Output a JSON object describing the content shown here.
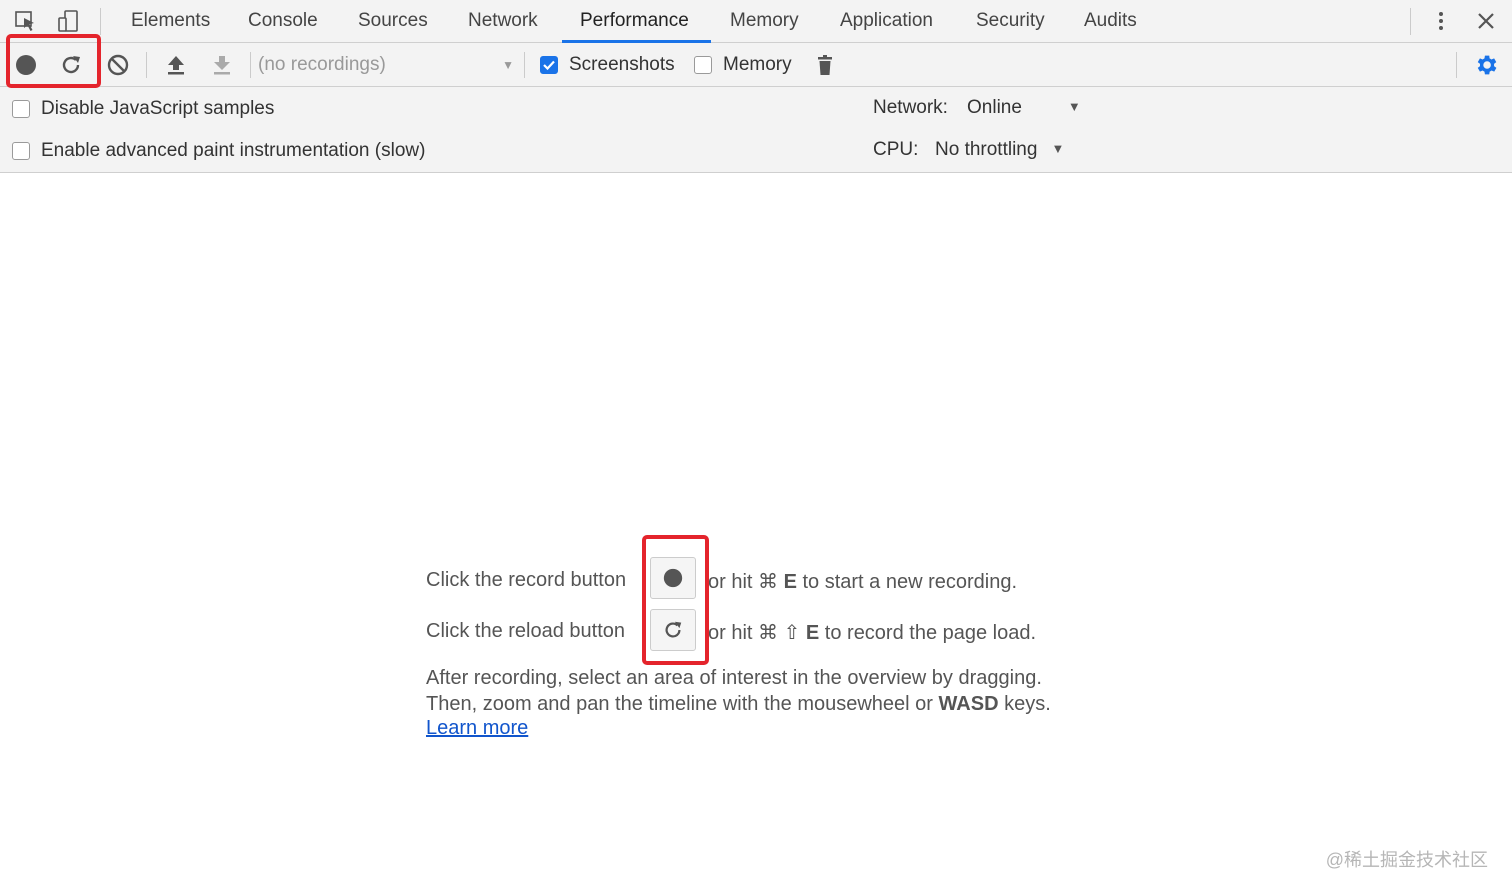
{
  "tabs": [
    {
      "label": "Elements"
    },
    {
      "label": "Console"
    },
    {
      "label": "Sources"
    },
    {
      "label": "Network"
    },
    {
      "label": "Performance",
      "active": true
    },
    {
      "label": "Memory"
    },
    {
      "label": "Application"
    },
    {
      "label": "Security"
    },
    {
      "label": "Audits"
    }
  ],
  "toolbar": {
    "recordings_select": "(no recordings)",
    "screenshots_label": "Screenshots",
    "screenshots_checked": true,
    "memory_label": "Memory",
    "memory_checked": false
  },
  "settings": {
    "disable_js_samples": "Disable JavaScript samples",
    "advanced_paint": "Enable advanced paint instrumentation (slow)",
    "network_label": "Network:",
    "network_value": "Online",
    "cpu_label": "CPU:",
    "cpu_value": "No throttling"
  },
  "landing": {
    "record_pre": "Click the record button",
    "record_post_a": "or hit ⌘ ",
    "record_key": "E",
    "record_post_b": " to start a new recording.",
    "reload_pre": "Click the reload button",
    "reload_post_a": "or hit ⌘ ⇧ ",
    "reload_key": "E",
    "reload_post_b": " to record the page load.",
    "after_1": "After recording, select an area of interest in the overview by dragging.",
    "after_2_a": "Then, zoom and pan the timeline with the mousewheel or ",
    "after_2_key": "WASD",
    "after_2_b": " keys.",
    "learn_more": "Learn more"
  },
  "watermark": "@稀土掘金技术社区",
  "colors": {
    "accent": "#1a73e8",
    "highlight": "#e4242c",
    "toolbar_bg": "#f3f3f3"
  },
  "icons": [
    "inspect-icon",
    "device-toggle-icon",
    "more-vert-icon",
    "close-icon",
    "record-icon",
    "reload-icon",
    "clear-icon",
    "upload-icon",
    "download-icon",
    "trash-icon",
    "gear-icon"
  ]
}
